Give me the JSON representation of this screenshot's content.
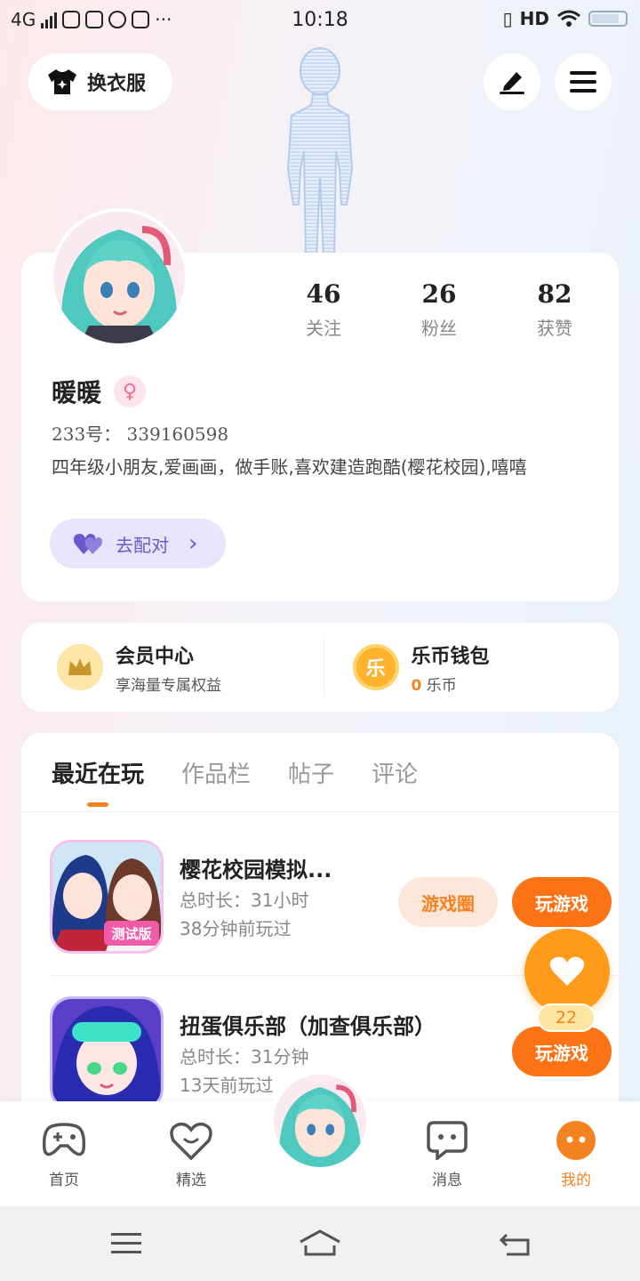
{
  "status_bar": {
    "network": "4G",
    "time": "10:18",
    "hd": "HD"
  },
  "header": {
    "outfit_label": "换衣服",
    "edit_icon": "pen-icon",
    "menu_icon": "menu-icon"
  },
  "profile": {
    "stats": [
      {
        "value": "46",
        "label": "关注"
      },
      {
        "value": "26",
        "label": "粉丝"
      },
      {
        "value": "82",
        "label": "获赞"
      }
    ],
    "nickname": "暖暖",
    "gender_symbol": "♀",
    "uid": "233号： 339160598",
    "bio": "四年级小朋友,爱画画，做手账,喜欢建造跑酷(樱花校园),嘻嘻",
    "match_label": "去配对",
    "match_arrow": "›"
  },
  "vip": {
    "member_title": "会员中心",
    "member_sub": "享海量专属权益",
    "wallet_title": "乐币钱包",
    "wallet_coin_glyph": "乐",
    "wallet_amount": "0",
    "wallet_unit": "乐币"
  },
  "tabs": [
    {
      "label": "最近在玩",
      "active": true
    },
    {
      "label": "作品栏",
      "active": false
    },
    {
      "label": "帖子",
      "active": false
    },
    {
      "label": "评论",
      "active": false
    }
  ],
  "games": [
    {
      "title": "樱花校园模拟...",
      "total_time": "总时长：31小时",
      "last_played": "38分钟前玩过",
      "circle_label": "游戏圈",
      "play_label": "玩游戏",
      "badge": "测试版"
    },
    {
      "title": "扭蛋俱乐部（加查俱乐部）",
      "total_time": "总时长：31分钟",
      "last_played": "13天前玩过",
      "play_label": "玩游戏"
    }
  ],
  "floating_like": {
    "count": "22"
  },
  "bottom_nav": [
    {
      "label": "首页",
      "icon": "gamepad-icon"
    },
    {
      "label": "精选",
      "icon": "heart-chat-icon"
    },
    {
      "label": "消息",
      "icon": "message-icon"
    },
    {
      "label": "我的",
      "icon": "me-icon",
      "active": true
    }
  ],
  "colors": {
    "accent": "#f58220",
    "play_button": "#fb7315",
    "match_bg": "#e7e4fb",
    "match_text": "#6a5acd"
  }
}
